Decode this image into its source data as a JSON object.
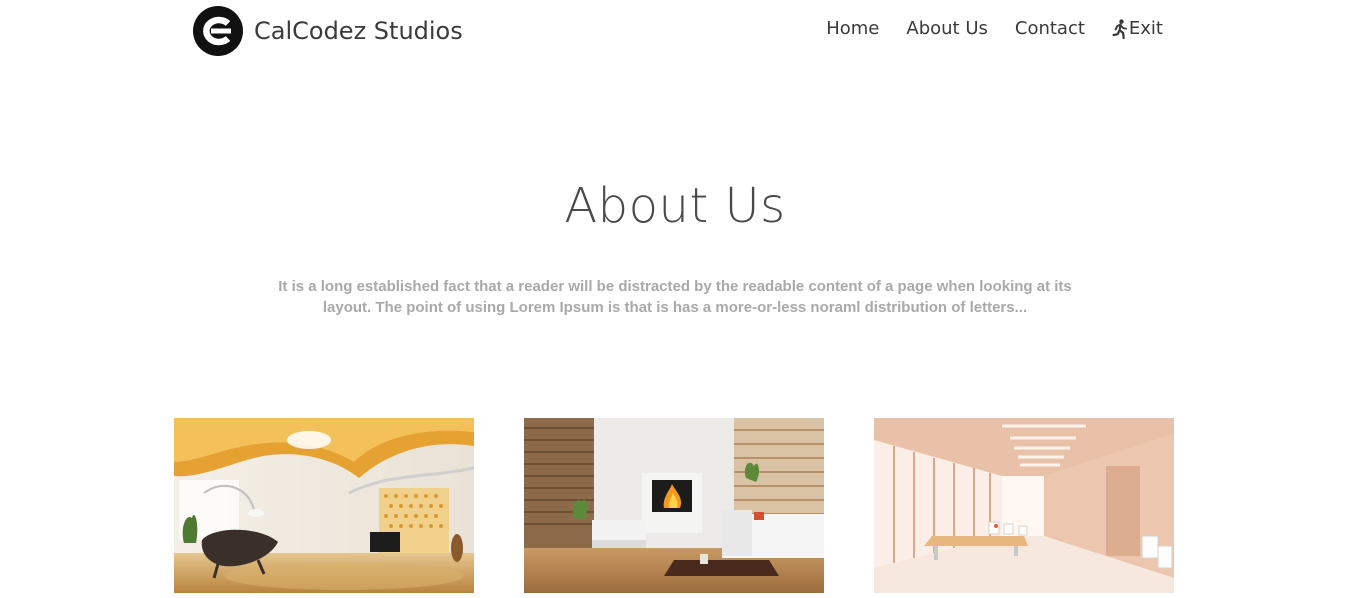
{
  "header": {
    "brand_name": "CalCodez Studios",
    "logo_icon": "calcodez-c-logo",
    "nav": [
      {
        "label": "Home"
      },
      {
        "label": "About Us"
      },
      {
        "label": "Contact"
      },
      {
        "label": "Exit",
        "icon": "running-man-exit-icon"
      }
    ]
  },
  "hero": {
    "title": "About Us",
    "text": "It is a long established fact that a reader will be distracted by the readable content of a page when looking at its layout. The point of using Lorem Ipsum is that is has a more-or-less noraml distribution of letters..."
  },
  "gallery": {
    "images": [
      {
        "subject": "modern living room with orange curved ceiling"
      },
      {
        "subject": "living room with fireplace and white sofas"
      },
      {
        "subject": "bright open-plan office corridor"
      }
    ]
  },
  "colors": {
    "text_dark": "#3a3a3a",
    "text_muted": "#a9a9a9",
    "background": "#ffffff",
    "accent_orange": "#e0a030"
  }
}
